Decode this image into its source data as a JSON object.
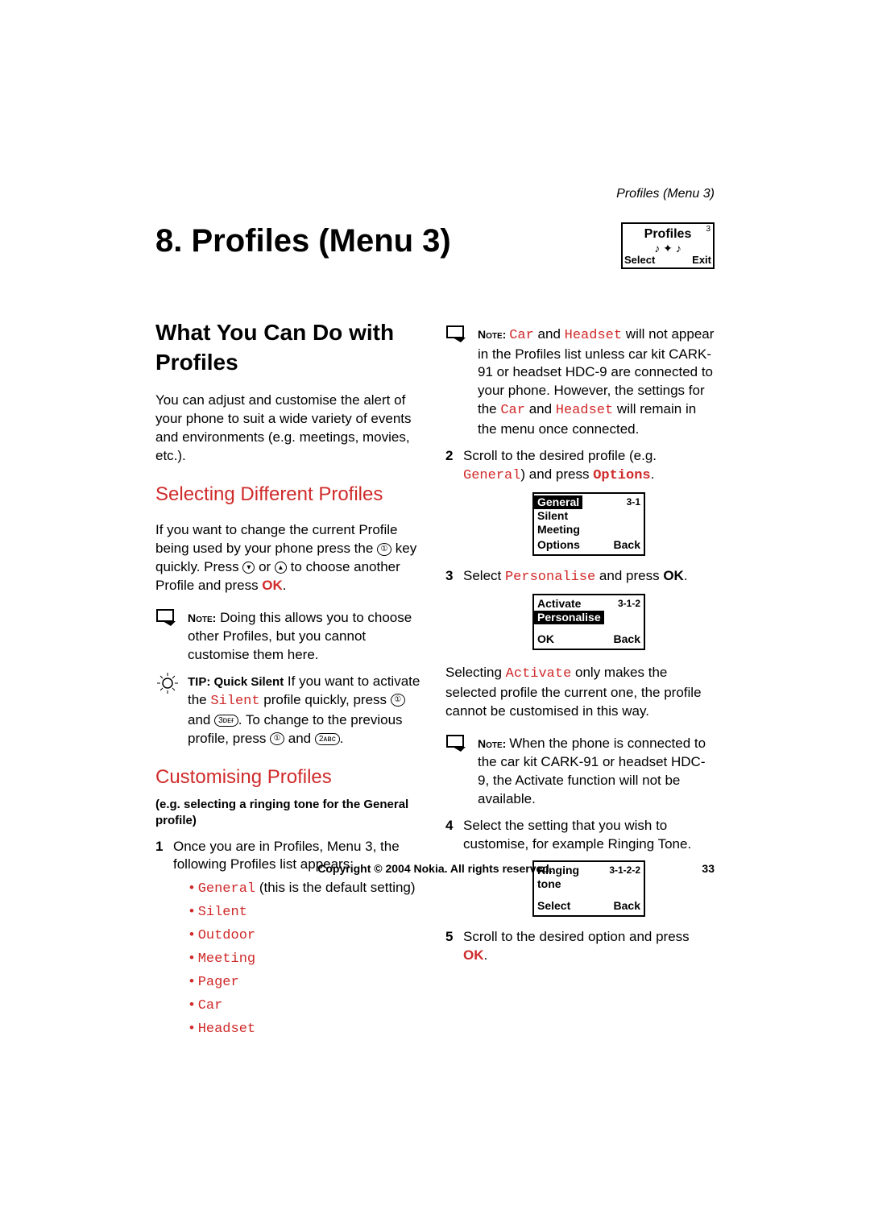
{
  "header": "Profiles (Menu 3)",
  "chapterTitle": "8. Profiles (Menu 3)",
  "topScreen": {
    "title": "Profiles",
    "left": "Select",
    "right": "Exit",
    "sig": "3"
  },
  "left": {
    "h2a": "What You Can Do with",
    "h2b": "Profiles",
    "intro": "You can adjust and customise the alert of your phone to suit a wide variety of events and environments (e.g. meetings, movies, etc.).",
    "h3a": "Selecting Different Profiles",
    "selPara1": "If you want to change the current Profile being used by your phone press the ",
    "selPara2": " key quickly. Press ",
    "selPara3": " or ",
    "selPara4": " to choose another Profile and press ",
    "ok": "OK",
    "note1Label": "Note:",
    "note1": " Doing this allows you to choose other Profiles, but you cannot customise them here.",
    "tipLabel": "TIP: Quick Silent",
    "tipA": " If you want to activate the ",
    "silent": "Silent",
    "tipB": " profile quickly, press ",
    "tipC": " and ",
    "tipD": ". To change to the previous profile, press ",
    "tipE": " and ",
    "h3b": "Customising Profiles",
    "sub": "(e.g. selecting a ringing tone for the General profile)",
    "step1": "Once you are in Profiles, Menu 3, the following Profiles list appears:",
    "list": {
      "general": "General",
      "generalSuffix": " (this is the default setting)",
      "silent": "Silent",
      "outdoor": "Outdoor",
      "meeting": "Meeting",
      "pager": "Pager",
      "car": "Car",
      "headset": "Headset"
    }
  },
  "right": {
    "noteLabel": "Note: ",
    "car": "Car",
    "headset": "Headset",
    "n1a": " and ",
    "n1b": " will not appear in the Profiles list unless car kit CARK-91 or headset HDC-9 are connected to your phone. However, the settings for the  ",
    "n1c": " and ",
    "n1d": " will remain in the menu once connected.",
    "step2a": "Scroll to the desired profile (e.g. ",
    "general": "General",
    "step2b": ") and press ",
    "options": "Options",
    "phone1": {
      "num": "3-1",
      "l1": "General",
      "l2": "Silent",
      "l3": "Meeting",
      "left": "Options",
      "right": "Back"
    },
    "step3a": "Select ",
    "personalise": "Personalise",
    "step3b": " and press ",
    "ok": "OK",
    "phone2": {
      "num": "3-1-2",
      "l1": "Activate",
      "l2": "Personalise",
      "left": "OK",
      "right": "Back"
    },
    "afterA": "Selecting ",
    "activate": "Activate",
    "afterB": " only makes the selected profile the current one, the profile cannot be customised in this way.",
    "note2": " When the phone is connected to the car kit CARK-91 or headset HDC-9, the Activate function will not be available.",
    "step4": "Select the setting that you wish to customise, for example Ringing Tone.",
    "phone3": {
      "num": "3-1-2-2",
      "l1": "Ringing",
      "l2": "tone",
      "left": "Select",
      "right": "Back"
    },
    "step5a": "Scroll to the desired option and press ",
    "step5b": "."
  },
  "footer": {
    "copy": "Copyright © 2004 Nokia. All rights reserved.",
    "page": "33"
  }
}
